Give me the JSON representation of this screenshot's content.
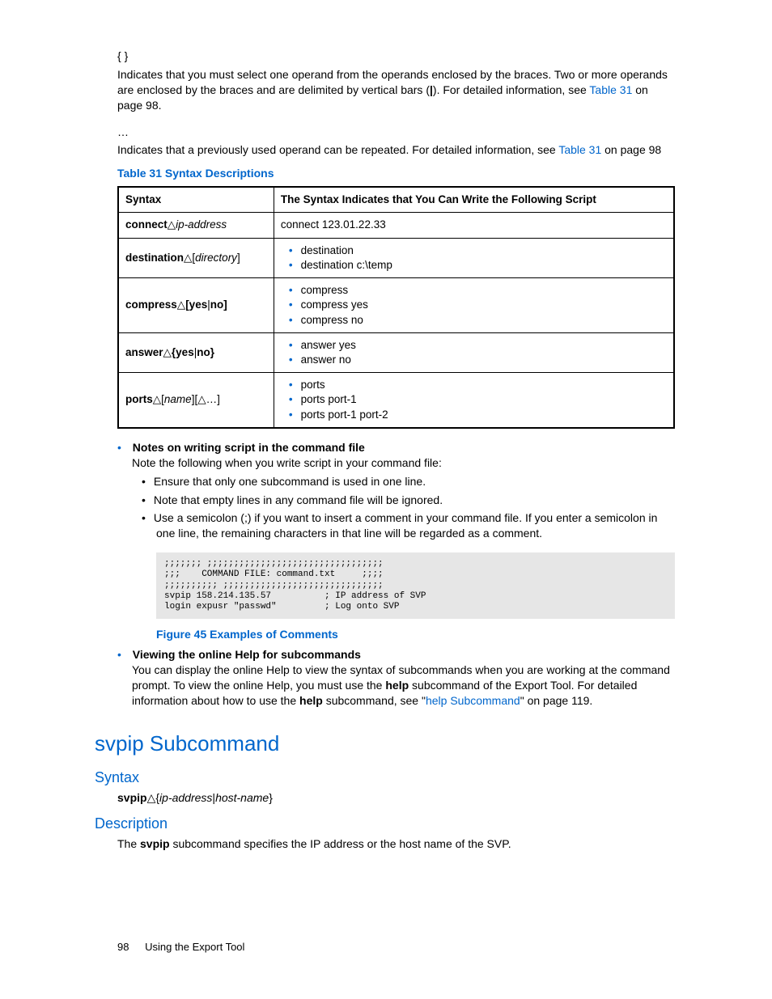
{
  "intro": {
    "braces": "{ }",
    "braces_para_a": "Indicates that you must select one operand from the operands enclosed by the braces.  Two or more operands are enclosed by the braces and are delimited by vertical bars (",
    "pipe": "|",
    "braces_para_b": ").  For detailed information, see ",
    "link1": "Table 31",
    "braces_para_c": " on page 98.",
    "dots": "…",
    "dots_para_a": "Indicates that a previously used operand can be repeated.  For detailed information, see ",
    "link2": "Table 31",
    "dots_para_b": " on page 98"
  },
  "table": {
    "caption": "Table 31 Syntax Descriptions",
    "h1": "Syntax",
    "h2": "The Syntax Indicates that You Can Write the Following Script",
    "rows": [
      {
        "s_bold": "connect",
        "s_tri": "△",
        "s_ital": "ip-address",
        "items": [
          "connect 123.01.22.33"
        ],
        "plain": true
      },
      {
        "s_bold": "destination",
        "s_tri": "△",
        "s_plain": "[",
        "s_ital": "directory",
        "s_plain2": "]",
        "items": [
          "destination",
          "destination c:\\temp"
        ]
      },
      {
        "s_bold": "compress",
        "s_tri": "△",
        "s_bold2": "[yes",
        "s_pipe": "|",
        "s_bold3": "no]",
        "items": [
          "compress",
          "compress yes",
          "compress no"
        ]
      },
      {
        "s_bold": "answer",
        "s_tri": "△",
        "s_bold2": "{yes",
        "s_pipe": "|",
        "s_bold3": "no}",
        "items": [
          "answer yes",
          "answer no"
        ]
      },
      {
        "s_bold": "ports",
        "s_tri": "△",
        "s_plain": "[",
        "s_ital": "name",
        "s_plain2": "][",
        "s_tri2": "△",
        "s_plain3": "…]",
        "items": [
          "ports",
          "ports port-1",
          "ports port-1 port-2"
        ]
      }
    ]
  },
  "notes": {
    "heading": "Notes on writing script in the command file",
    "intro": "Note the following when you write script in your command file:",
    "items": [
      "Ensure that only one subcommand is used in one line.",
      "Note that empty lines in any command file will be ignored.",
      "Use a semicolon (;) if you want to insert a comment in your command file.  If you enter a semicolon in one line, the remaining characters in that line will be regarded as a comment."
    ]
  },
  "code": ";;;;;;; ;;;;;;;;;;;;;;;;;;;;;;;;;;;;;;;;;\n;;;    COMMAND FILE: command.txt     ;;;;\n;;;;;;;;;; ;;;;;;;;;;;;;;;;;;;;;;;;;;;;;;\nsvpip 158.214.135.57          ; IP address of SVP\nlogin expusr \"passwd\"         ; Log onto SVP",
  "fig_caption": "Figure 45 Examples of Comments",
  "view": {
    "heading": "Viewing the online Help for subcommands",
    "p_a": "You can display the online Help to view the syntax of subcommands when you are working at the command prompt.  To view the online Help, you must use the ",
    "help1": "help",
    "p_b": " subcommand of the Export Tool.  For detailed information about how to use the ",
    "help2": "help",
    "p_c": " subcommand, see \"",
    "link": "help Subcommand",
    "p_d": "\" on page 119."
  },
  "svpip": {
    "title": "svpip Subcommand",
    "syntax_h": "Syntax",
    "syntax_bold": "svpip",
    "syntax_tri": "△",
    "syntax_rest": "{",
    "syntax_ital": "ip-address",
    "syntax_pipe": "|",
    "syntax_ital2": "host-name",
    "syntax_close": "}",
    "desc_h": "Description",
    "desc_a": "The ",
    "desc_bold": "svpip",
    "desc_b": " subcommand specifies the IP address or the host name of the SVP."
  },
  "footer": {
    "page": "98",
    "text": "Using the Export Tool"
  }
}
